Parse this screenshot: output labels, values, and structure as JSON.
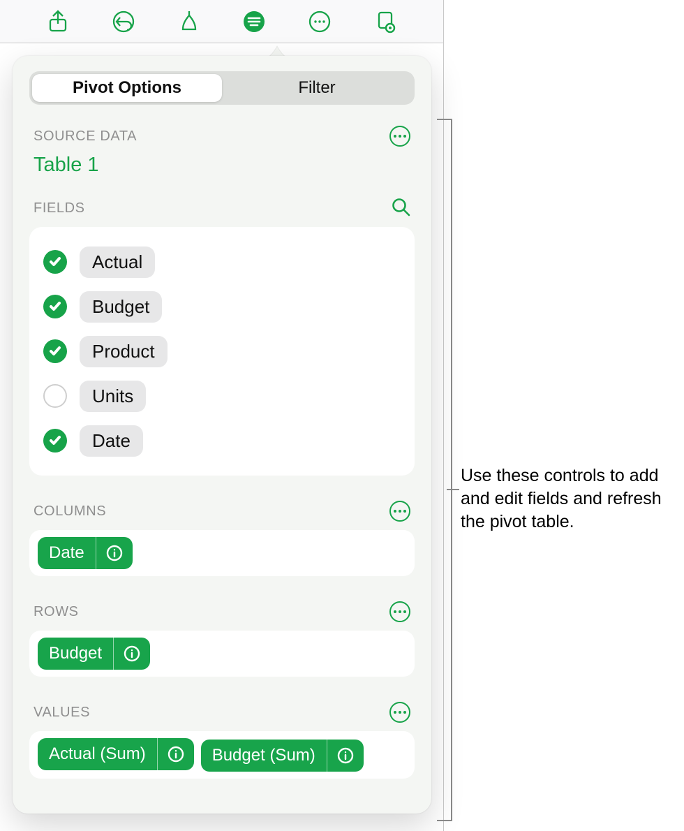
{
  "toolbar": {
    "icons": [
      "share-icon",
      "undo-icon",
      "format-brush-icon",
      "pivot-options-icon",
      "more-icon",
      "smart-category-icon"
    ]
  },
  "segmented": {
    "pivot": "Pivot Options",
    "filter": "Filter"
  },
  "sourceData": {
    "header": "SOURCE DATA",
    "table": "Table 1"
  },
  "fields": {
    "header": "FIELDS",
    "items": [
      {
        "label": "Actual",
        "checked": true
      },
      {
        "label": "Budget",
        "checked": true
      },
      {
        "label": "Product",
        "checked": true
      },
      {
        "label": "Units",
        "checked": false
      },
      {
        "label": "Date",
        "checked": true
      }
    ]
  },
  "columns": {
    "header": "COLUMNS",
    "chips": [
      {
        "label": "Date"
      }
    ]
  },
  "rows": {
    "header": "ROWS",
    "chips": [
      {
        "label": "Budget"
      }
    ]
  },
  "values": {
    "header": "VALUES",
    "chips": [
      {
        "label": "Actual (Sum)"
      },
      {
        "label": "Budget (Sum)"
      }
    ]
  },
  "callout": "Use these controls to add and edit fields and refresh the pivot table."
}
